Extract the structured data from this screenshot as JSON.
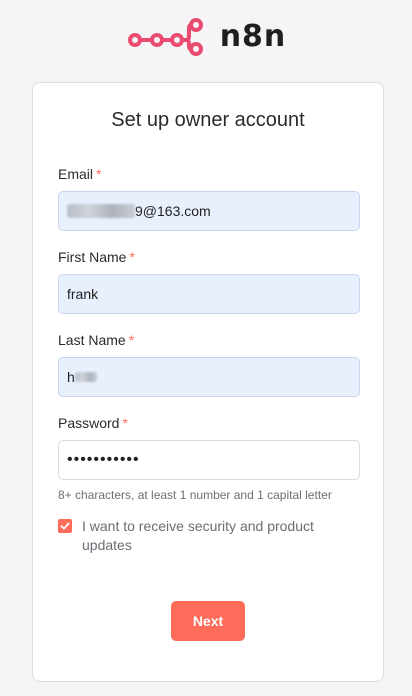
{
  "brand": {
    "name": "n8n",
    "accent": "#ff6d5a",
    "logo_color": "#ea4b71"
  },
  "form": {
    "title": "Set up owner account",
    "required_marker": "*",
    "email": {
      "label": "Email",
      "value_visible_suffix": "9@163.com"
    },
    "first_name": {
      "label": "First Name",
      "value": "frank"
    },
    "last_name": {
      "label": "Last Name",
      "value_visible_prefix": "h"
    },
    "password": {
      "label": "Password",
      "value": "•••••••••••",
      "hint": "8+ characters, at least 1 number and 1 capital letter"
    },
    "updates_checkbox": {
      "label": "I want to receive security and product updates",
      "checked": true
    },
    "submit_label": "Next"
  }
}
